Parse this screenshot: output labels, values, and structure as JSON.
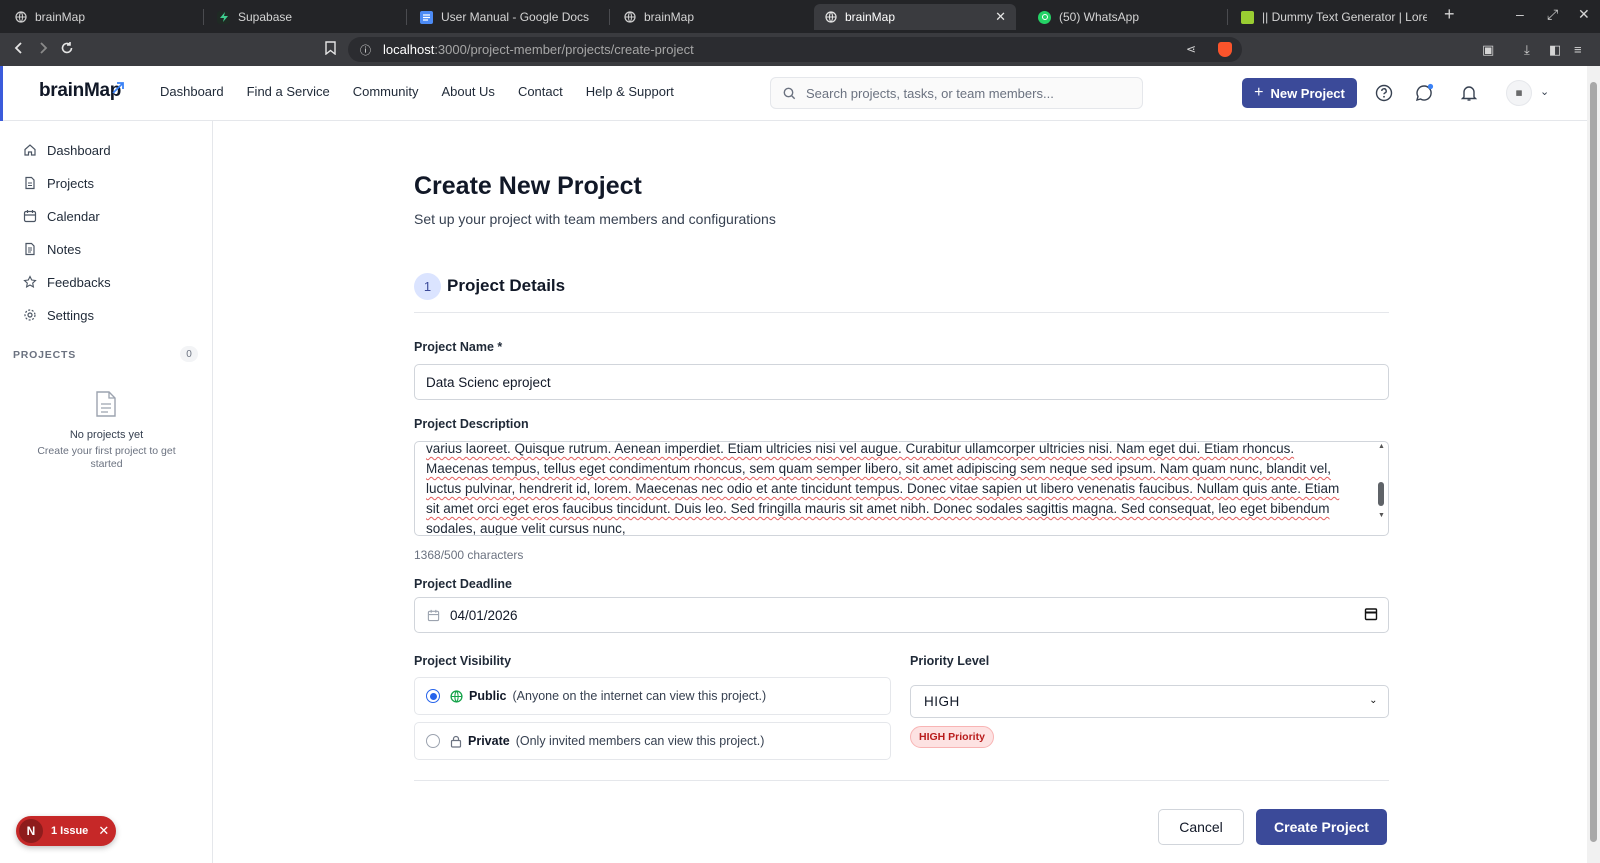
{
  "browser": {
    "tabs": [
      {
        "title": "brainMap",
        "icon": "globe-icon"
      },
      {
        "title": "Supabase",
        "icon": "supabase-icon"
      },
      {
        "title": "User Manual - Google Docs",
        "icon": "docs-icon"
      },
      {
        "title": "brainMap",
        "icon": "globe-icon"
      },
      {
        "title": "brainMap",
        "icon": "globe-icon",
        "active": true
      },
      {
        "title": "(50) WhatsApp",
        "icon": "whatsapp-icon"
      },
      {
        "title": "|| Dummy Text Generator | Lore",
        "icon": "lorem-icon"
      }
    ],
    "url_host": "localhost",
    "url_path": ":3000/project-member/projects/create-project"
  },
  "header": {
    "logo": "brainMap",
    "nav": [
      "Dashboard",
      "Find a Service",
      "Community",
      "About Us",
      "Contact",
      "Help & Support"
    ],
    "search_placeholder": "Search projects, tasks, or team members...",
    "new_project_label": "New Project",
    "accent": "#3b4a99"
  },
  "sidebar": {
    "items": [
      "Dashboard",
      "Projects",
      "Calendar",
      "Notes",
      "Feedbacks",
      "Settings"
    ],
    "section_title": "PROJECTS",
    "project_count": "0",
    "empty_title": "No projects yet",
    "empty_sub": "Create your first project to get started"
  },
  "issue_badge": {
    "letter": "N",
    "label": "1 Issue"
  },
  "form": {
    "title": "Create New Project",
    "subtitle": "Set up your project with team members and configurations",
    "step_number": "1",
    "step_title": "Project Details",
    "name_label": "Project Name *",
    "name_value": "Data Scienc eproject",
    "desc_label": "Project Description",
    "desc_value": "varius laoreet. Quisque rutrum. Aenean imperdiet. Etiam ultricies nisi vel augue. Curabitur ullamcorper ultricies nisi. Nam eget dui. Etiam rhoncus. Maecenas tempus, tellus eget condimentum rhoncus, sem quam semper libero, sit amet adipiscing sem neque sed ipsum. Nam quam nunc, blandit vel, luctus pulvinar, hendrerit id, lorem. Maecenas nec odio et ante tincidunt tempus. Donec vitae sapien ut libero venenatis faucibus. Nullam quis ante. Etiam sit amet orci eget eros faucibus tincidunt. Duis leo. Sed fringilla mauris sit amet nibh. Donec sodales sagittis magna. Sed consequat, leo eget bibendum sodales, augue velit cursus nunc,",
    "char_count": "1368/500 characters",
    "deadline_label": "Project Deadline",
    "deadline_value": "04/01/2026",
    "visibility_label": "Project Visibility",
    "public_title": "Public",
    "public_desc": "(Anyone on the internet can view this project.)",
    "private_title": "Private",
    "private_desc": "(Only invited members can view this project.)",
    "priority_label": "Priority Level",
    "priority_value": "HIGH",
    "priority_badge": "HIGH Priority",
    "cancel_label": "Cancel",
    "create_label": "Create Project"
  }
}
